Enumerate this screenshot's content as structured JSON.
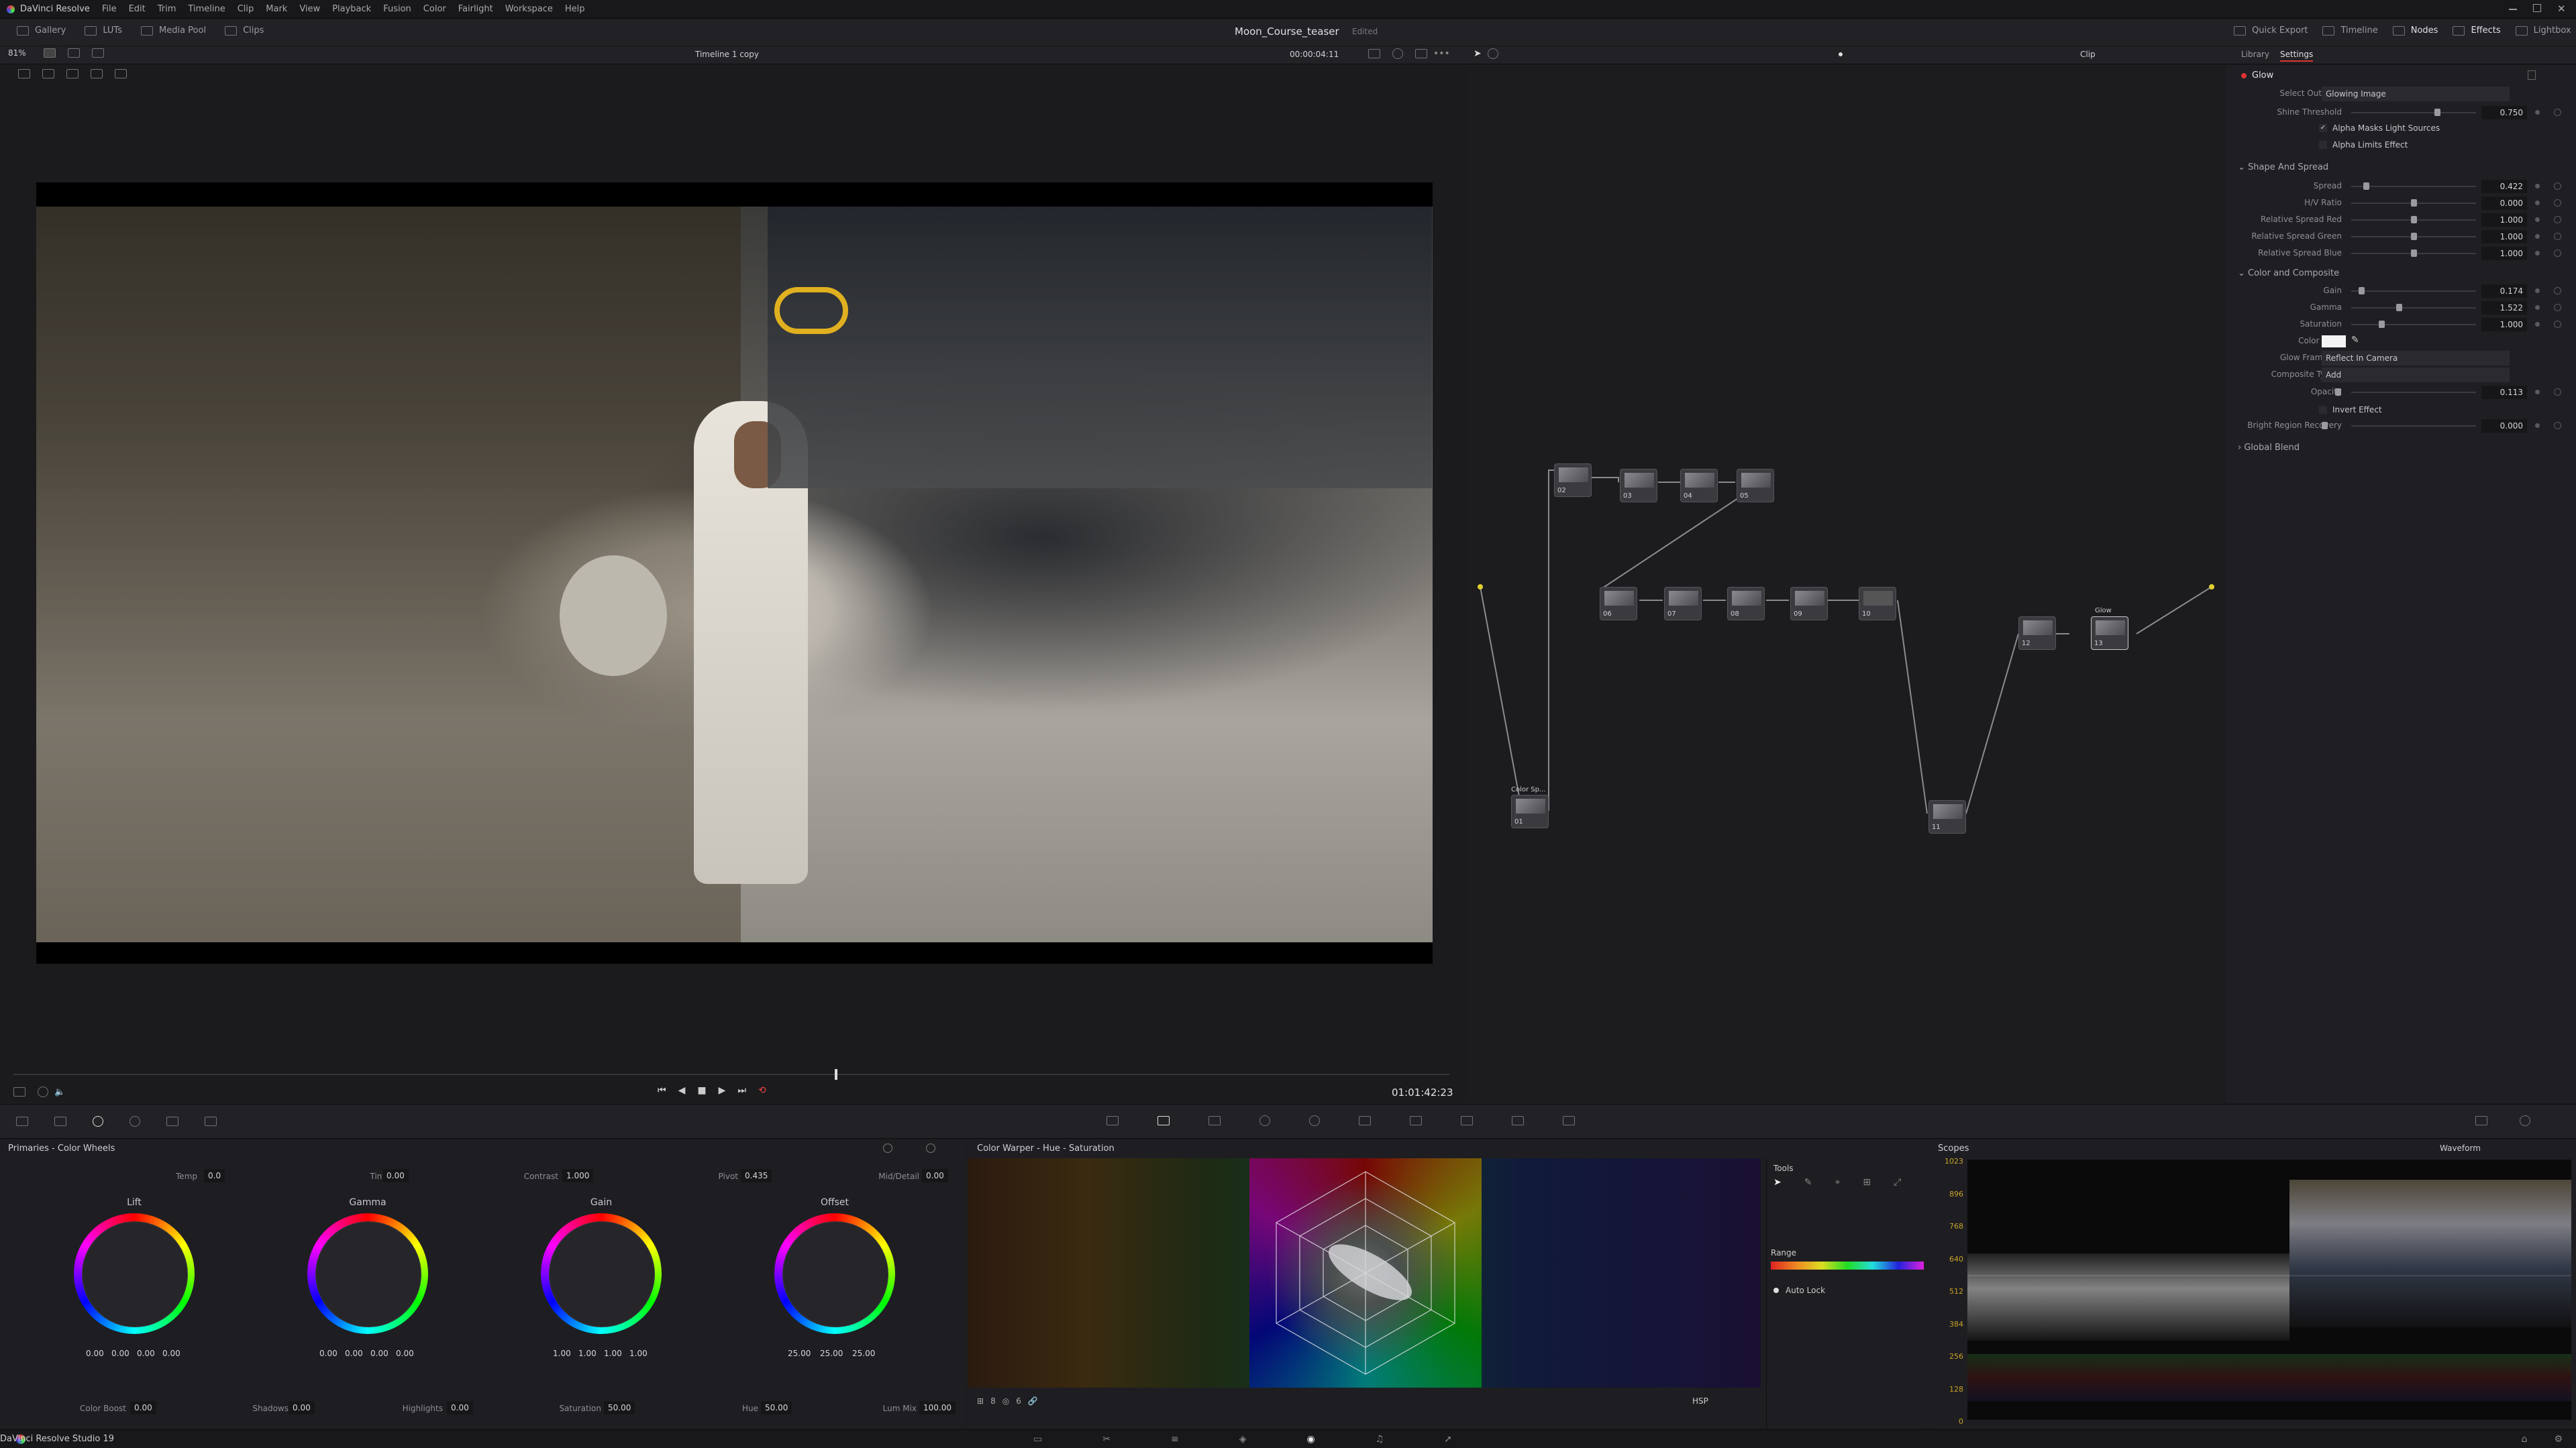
{
  "menu": {
    "app": "DaVinci Resolve",
    "items": [
      "File",
      "Edit",
      "Trim",
      "Timeline",
      "Clip",
      "Mark",
      "View",
      "Playback",
      "Fusion",
      "Color",
      "Fairlight",
      "Workspace",
      "Help"
    ]
  },
  "toolbar": {
    "gallery": "Gallery",
    "luts": "LUTs",
    "media_pool": "Media Pool",
    "clips": "Clips",
    "project_title": "Moon_Course_teaser",
    "project_status": "Edited",
    "quick_export": "Quick Export",
    "timeline": "Timeline",
    "nodes": "Nodes",
    "effects": "Effects",
    "lightbox": "Lightbox"
  },
  "viewer": {
    "zoom": "81%",
    "timeline_name": "Timeline 1 copy",
    "timecode_top": "00:00:04:11",
    "timecode_bottom": "01:01:42:23"
  },
  "node_editor": {
    "mode": "Clip",
    "nodes": [
      {
        "id": "02",
        "label": "02"
      },
      {
        "id": "03",
        "label": "03"
      },
      {
        "id": "04",
        "label": "04"
      },
      {
        "id": "05",
        "label": "05"
      },
      {
        "id": "06",
        "label": "06"
      },
      {
        "id": "07",
        "label": "07"
      },
      {
        "id": "08",
        "label": "08"
      },
      {
        "id": "09",
        "label": "09"
      },
      {
        "id": "10",
        "label": "10"
      },
      {
        "id": "01",
        "label": "01",
        "title": "Color Sp..."
      },
      {
        "id": "11",
        "label": "11"
      },
      {
        "id": "12",
        "label": "12"
      },
      {
        "id": "13",
        "label": "13",
        "title": "Glow"
      }
    ]
  },
  "inspector": {
    "tabs": [
      "Library",
      "Settings"
    ],
    "effect": "Glow",
    "select_output_label": "Select Output",
    "select_output": "Glowing Image",
    "shine_threshold_label": "Shine Threshold",
    "shine_threshold": "0.750",
    "alpha_masks": "Alpha Masks Light Sources",
    "alpha_limits": "Alpha Limits Effect",
    "shape_section": "Shape And Spread",
    "shape_rows": [
      {
        "label": "Spread",
        "value": "0.422",
        "pos": 0.12
      },
      {
        "label": "H/V Ratio",
        "value": "0.000",
        "pos": 0.5
      },
      {
        "label": "Relative Spread Red",
        "value": "1.000",
        "pos": 0.5
      },
      {
        "label": "Relative Spread Green",
        "value": "1.000",
        "pos": 0.5
      },
      {
        "label": "Relative Spread Blue",
        "value": "1.000",
        "pos": 0.5
      }
    ],
    "color_section": "Color and Composite",
    "color_rows": [
      {
        "label": "Gain",
        "value": "0.174",
        "pos": 0.08
      },
      {
        "label": "Gamma",
        "value": "1.522",
        "pos": 0.38
      },
      {
        "label": "Saturation",
        "value": "1.000",
        "pos": 0.24
      }
    ],
    "color_filter_label": "Color Filter",
    "glow_framing_label": "Glow Framing",
    "glow_framing": "Reflect In Camera",
    "composite_label": "Composite Type",
    "composite": "Add",
    "opacity_label": "Opacity",
    "opacity": "0.113",
    "invert": "Invert Effect",
    "bright_label": "Bright Region Recovery",
    "bright": "0.000",
    "global_blend": "Global Blend"
  },
  "primaries": {
    "title": "Primaries - Color Wheels",
    "temp_label": "Temp",
    "temp": "0.0",
    "tint_label": "Tint",
    "tint": "0.00",
    "contrast_label": "Contrast",
    "contrast": "1.000",
    "pivot_label": "Pivot",
    "pivot": "0.435",
    "middetail_label": "Mid/Detail",
    "middetail": "0.00",
    "wheels": [
      {
        "name": "Lift",
        "vals": [
          "0.00",
          "0.00",
          "0.00",
          "0.00"
        ]
      },
      {
        "name": "Gamma",
        "vals": [
          "0.00",
          "0.00",
          "0.00",
          "0.00"
        ]
      },
      {
        "name": "Gain",
        "vals": [
          "1.00",
          "1.00",
          "1.00",
          "1.00"
        ]
      },
      {
        "name": "Offset",
        "vals": [
          "25.00",
          "25.00",
          "25.00"
        ]
      }
    ],
    "colorboost_label": "Color Boost",
    "colorboost": "0.00",
    "shadows_label": "Shadows",
    "shadows": "0.00",
    "highlights_label": "Highlights",
    "highlights": "0.00",
    "saturation_label": "Saturation",
    "saturation": "50.00",
    "hue_label": "Hue",
    "hue": "50.00",
    "lummix_label": "Lum Mix",
    "lummix": "100.00"
  },
  "warper": {
    "title": "Color Warper - Hue - Saturation",
    "tools": "Tools",
    "range": "Range",
    "autolock": "Auto Lock",
    "mode": "HSP",
    "grid1": "8",
    "grid2": "6"
  },
  "scopes": {
    "title": "Scopes",
    "type": "Waveform",
    "ticks": [
      "1023",
      "896",
      "768",
      "640",
      "512",
      "384",
      "256",
      "128",
      "0"
    ]
  },
  "status": {
    "app": "DaVinci Resolve Studio 19"
  }
}
